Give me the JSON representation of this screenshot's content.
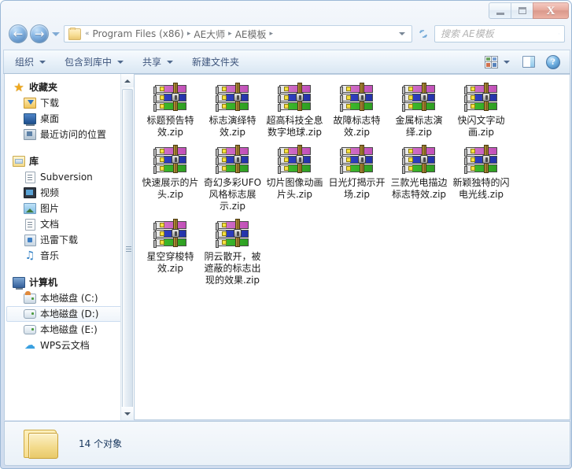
{
  "window": {
    "controls": {
      "minimize": "—",
      "maximize": "□",
      "close": "X"
    }
  },
  "address_bar": {
    "back_label": "←",
    "forward_label": "→",
    "recent_pages_label": "▾",
    "path_prefix": "«",
    "breadcrumbs": [
      "Program Files (x86)",
      "AE大师",
      "AE模板"
    ],
    "separator": "▸",
    "refresh_label": "refresh",
    "search_placeholder": "搜索 AE模板"
  },
  "toolbar": {
    "items": [
      {
        "label": "组织",
        "has_caret": true
      },
      {
        "label": "包含到库中",
        "has_caret": true
      },
      {
        "label": "共享",
        "has_caret": true
      },
      {
        "label": "新建文件夹",
        "has_caret": false
      }
    ],
    "view_button": "change-view",
    "view_caret": "▾",
    "preview_pane_button": "show-preview-pane",
    "help_button": "?"
  },
  "nav_pane": {
    "groups": [
      {
        "header": {
          "label": "收藏夹",
          "icon": "star-icon"
        },
        "items": [
          {
            "label": "下载",
            "icon": "downloads-folder-icon",
            "selected": false
          },
          {
            "label": "桌面",
            "icon": "desktop-icon",
            "selected": false
          },
          {
            "label": "最近访问的位置",
            "icon": "recent-places-icon",
            "selected": false
          }
        ]
      },
      {
        "header": {
          "label": "库",
          "icon": "library-icon"
        },
        "items": [
          {
            "label": "Subversion",
            "icon": "document-icon",
            "selected": false
          },
          {
            "label": "视频",
            "icon": "video-icon",
            "selected": false
          },
          {
            "label": "图片",
            "icon": "picture-icon",
            "selected": false
          },
          {
            "label": "文档",
            "icon": "document-icon",
            "selected": false
          },
          {
            "label": "迅雷下载",
            "icon": "xunlei-icon",
            "selected": false
          },
          {
            "label": "音乐",
            "icon": "music-icon",
            "selected": false
          }
        ]
      },
      {
        "header": {
          "label": "计算机",
          "icon": "computer-icon"
        },
        "items": [
          {
            "label": "本地磁盘 (C:)",
            "icon": "system-drive-icon",
            "selected": false
          },
          {
            "label": "本地磁盘 (D:)",
            "icon": "drive-icon",
            "selected": true
          },
          {
            "label": "本地磁盘 (E:)",
            "icon": "drive-icon",
            "selected": false
          },
          {
            "label": "WPS云文档",
            "icon": "cloud-icon",
            "selected": false
          }
        ]
      }
    ]
  },
  "files": [
    {
      "name": "标题预告特效.zip",
      "icon": "winrar-archive-icon"
    },
    {
      "name": "标志演绎特效.zip",
      "icon": "winrar-archive-icon"
    },
    {
      "name": "超高科技全息数字地球.zip",
      "icon": "winrar-archive-icon"
    },
    {
      "name": "故障标志特效.zip",
      "icon": "winrar-archive-icon"
    },
    {
      "name": "金属标志演绎.zip",
      "icon": "winrar-archive-icon"
    },
    {
      "name": "快闪文字动画.zip",
      "icon": "winrar-archive-icon"
    },
    {
      "name": "快速展示的片头.zip",
      "icon": "winrar-archive-icon"
    },
    {
      "name": "奇幻多彩UFO风格标志展示.zip",
      "icon": "winrar-archive-icon"
    },
    {
      "name": "切片图像动画片头.zip",
      "icon": "winrar-archive-icon"
    },
    {
      "name": "日光灯揭示开场.zip",
      "icon": "winrar-archive-icon"
    },
    {
      "name": "三款光电描边标志特效.zip",
      "icon": "winrar-archive-icon"
    },
    {
      "name": "新颖独特的闪电光线.zip",
      "icon": "winrar-archive-icon"
    },
    {
      "name": "星空穿梭特效.zip",
      "icon": "winrar-archive-icon"
    },
    {
      "name": "阴云散开，被遮蔽的标志出现的效果.zip",
      "icon": "winrar-archive-icon"
    }
  ],
  "status_bar": {
    "item_count_text": "14 个对象",
    "folder_icon": "folder-icon"
  },
  "colors": {
    "accent_blue": "#17365d",
    "frame_border": "#9cb8d6",
    "close_red": "#b73a22",
    "selection_bg": "#eef4fa"
  }
}
